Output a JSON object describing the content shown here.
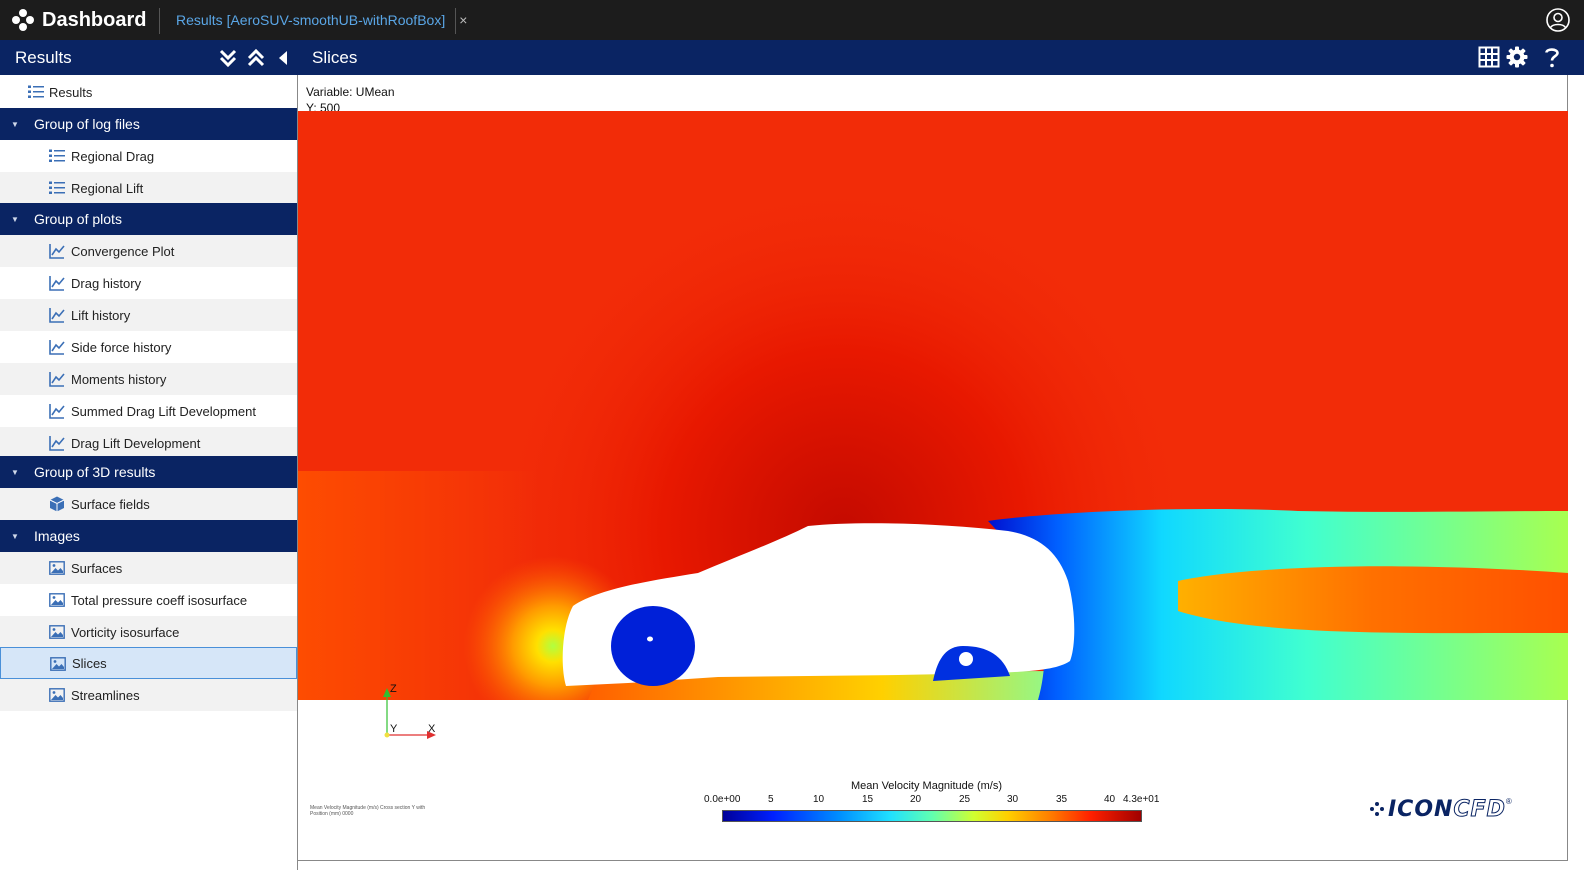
{
  "app": {
    "title": "Dashboard",
    "tab_label": "Results [AeroSUV-smoothUB-withRoofBox]",
    "tab_close": "×"
  },
  "left_panel": {
    "title": "Results",
    "buttons": [
      "expand-all-icon",
      "collapse-all-icon",
      "collapse-panel-icon"
    ]
  },
  "right_panel": {
    "title": "Slices",
    "buttons": [
      "grid-icon",
      "gear-icon",
      "help-icon"
    ]
  },
  "tree": {
    "root": {
      "label": "Results",
      "icon": "list-icon"
    },
    "groups": [
      {
        "label": "Group of log files",
        "items": [
          {
            "label": "Regional Drag",
            "icon": "list-icon"
          },
          {
            "label": "Regional Lift",
            "icon": "list-icon"
          }
        ]
      },
      {
        "label": "Group of plots",
        "items": [
          {
            "label": "Convergence Plot",
            "icon": "chart-line-icon"
          },
          {
            "label": "Drag history",
            "icon": "chart-line-icon"
          },
          {
            "label": "Lift history",
            "icon": "chart-line-icon"
          },
          {
            "label": "Side force history",
            "icon": "chart-line-icon"
          },
          {
            "label": "Moments history",
            "icon": "chart-line-icon"
          },
          {
            "label": "Summed Drag Lift Development",
            "icon": "chart-line-icon"
          },
          {
            "label": "Drag Lift Development",
            "icon": "chart-line-icon"
          }
        ]
      },
      {
        "label": "Group of 3D results",
        "items": [
          {
            "label": "Surface fields",
            "icon": "cube-icon"
          }
        ]
      },
      {
        "label": "Images",
        "items": [
          {
            "label": "Surfaces",
            "icon": "image-icon"
          },
          {
            "label": "Total pressure coeff isosurface",
            "icon": "image-icon"
          },
          {
            "label": "Vorticity isosurface",
            "icon": "image-icon"
          },
          {
            "label": "Slices",
            "icon": "image-icon",
            "selected": true
          },
          {
            "label": "Streamlines",
            "icon": "image-icon"
          }
        ]
      }
    ]
  },
  "viewer": {
    "variable_line": "Variable: UMean",
    "position_line": "Y: 500",
    "axes": {
      "z": "Z",
      "y": "Y",
      "x": "X"
    },
    "colorbar": {
      "title": "Mean Velocity Magnitude (m/s)",
      "ticks": [
        "0.0e+00",
        "5",
        "10",
        "15",
        "20",
        "25",
        "30",
        "35",
        "40",
        "4.3e+01"
      ],
      "min": 0,
      "max": 43,
      "colors": [
        "#000098",
        "#0020ff",
        "#0090ff",
        "#20e0ff",
        "#60ffb0",
        "#d0ff30",
        "#ffd000",
        "#ff8000",
        "#ff2000",
        "#a00000"
      ]
    },
    "caption": "Mean Velocity Magnitude (m/s)  Cross section Y with Position (mm) 0000",
    "logo": {
      "part1": "ICON",
      "part2": "CFD",
      "mark": "®"
    }
  }
}
